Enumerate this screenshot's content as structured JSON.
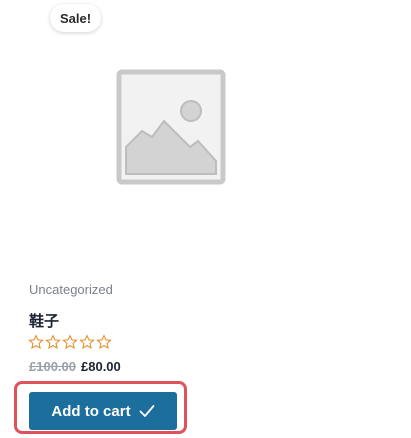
{
  "product": {
    "badge": "Sale!",
    "category": "Uncategorized",
    "title": "鞋子",
    "rating": {
      "value": 0,
      "max": 5
    },
    "price": {
      "old": "£100.00",
      "current": "£80.00"
    },
    "add_to_cart_label": "Add to cart",
    "button_icon": "check-icon",
    "placeholder_icon": "image-placeholder-icon"
  },
  "colors": {
    "button": "#1c6e9c",
    "highlight": "#e0525a",
    "star": "#e58e2b"
  }
}
